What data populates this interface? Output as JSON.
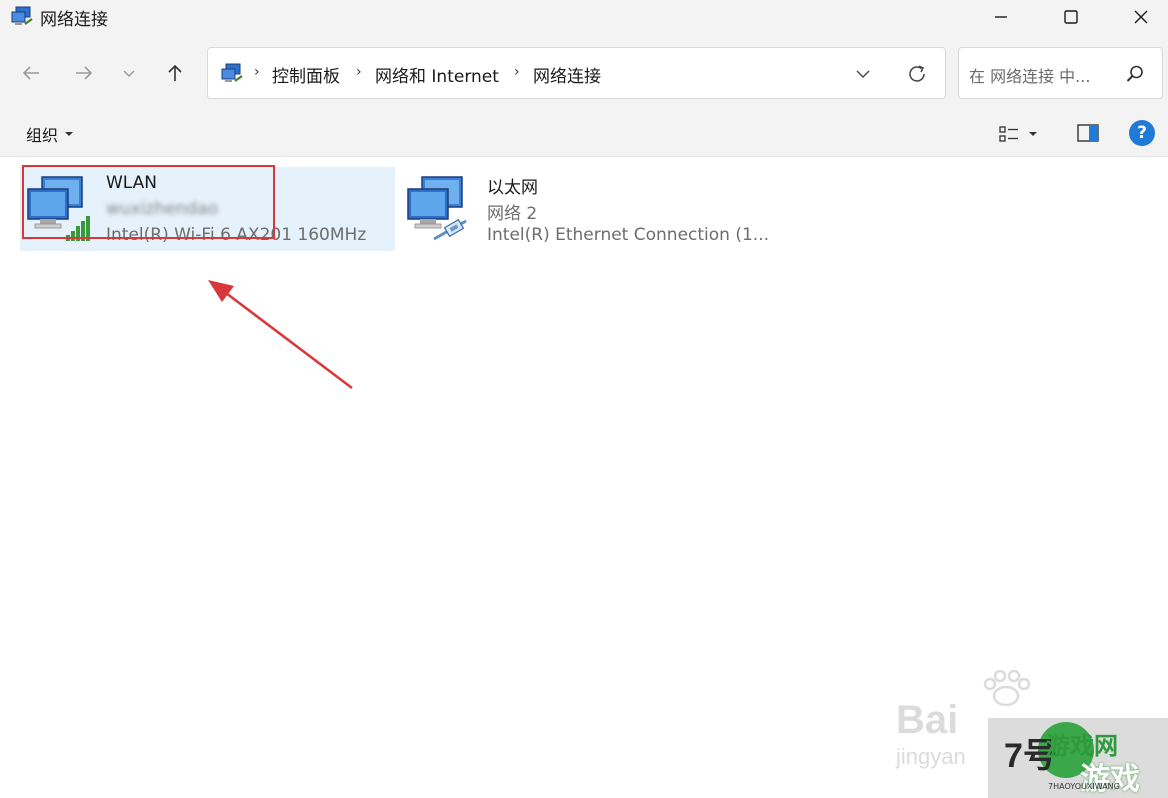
{
  "window": {
    "title": "网络连接"
  },
  "address": {
    "crumbs": [
      "控制面板",
      "网络和 Internet",
      "网络连接"
    ]
  },
  "search": {
    "placeholder": "在 网络连接 中..."
  },
  "toolbar": {
    "organize_label": "组织",
    "help_label": "?"
  },
  "connections": [
    {
      "name": "WLAN",
      "network": "wuxizhendao",
      "device": "Intel(R) Wi-Fi 6 AX201 160MHz",
      "icon": "wifi-network-icon",
      "selected": true
    },
    {
      "name": "以太网",
      "network": "网络 2",
      "device": "Intel(R) Ethernet Connection (1...",
      "icon": "ethernet-network-icon",
      "selected": false
    }
  ],
  "watermarks": {
    "baidu": "Bai",
    "jingyan": "jingyan",
    "game_number": "7号",
    "game_line1": "游戏网",
    "game_line2": "游戏",
    "game_small": "7HAOYOUXIWANG"
  },
  "colors": {
    "selection": "#e5f1fb",
    "annotation": "#d9383a",
    "accent": "#1f7ad8"
  }
}
